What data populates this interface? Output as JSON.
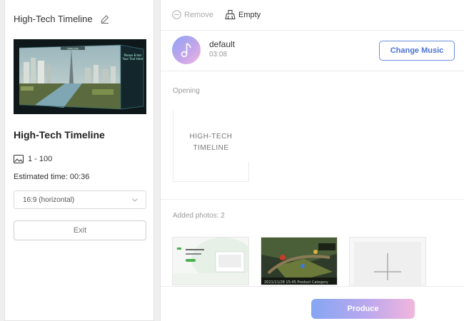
{
  "project": {
    "header_title": "High-Tech Timeline",
    "title": "High-Tech Timeline",
    "photo_range": "1 - 100",
    "estimated_time": "Estimated time: 00:36",
    "aspect_ratio": "16:9 (horizontal)",
    "exit_label": "Exit"
  },
  "thumbnail": {
    "overlay_text_top": "TIMELINE",
    "overlay_text_side": "Please Enter Your Text Here"
  },
  "toolbar": {
    "remove_label": "Remove",
    "empty_label": "Empty"
  },
  "music": {
    "name": "default",
    "duration": "03:08",
    "change_label": "Change Music"
  },
  "opening": {
    "label": "Opening",
    "card_text": "HIGH-TECH TIMELINE"
  },
  "photos": {
    "label": "Added photos: 2",
    "photo2_caption": "2021/11/28 15:45 Product Category"
  },
  "produce_label": "Produce",
  "colors": {
    "accent": "#4b74d1",
    "produce_gradient_start": "#85a6f2",
    "produce_gradient_end": "#f2b6dc"
  }
}
